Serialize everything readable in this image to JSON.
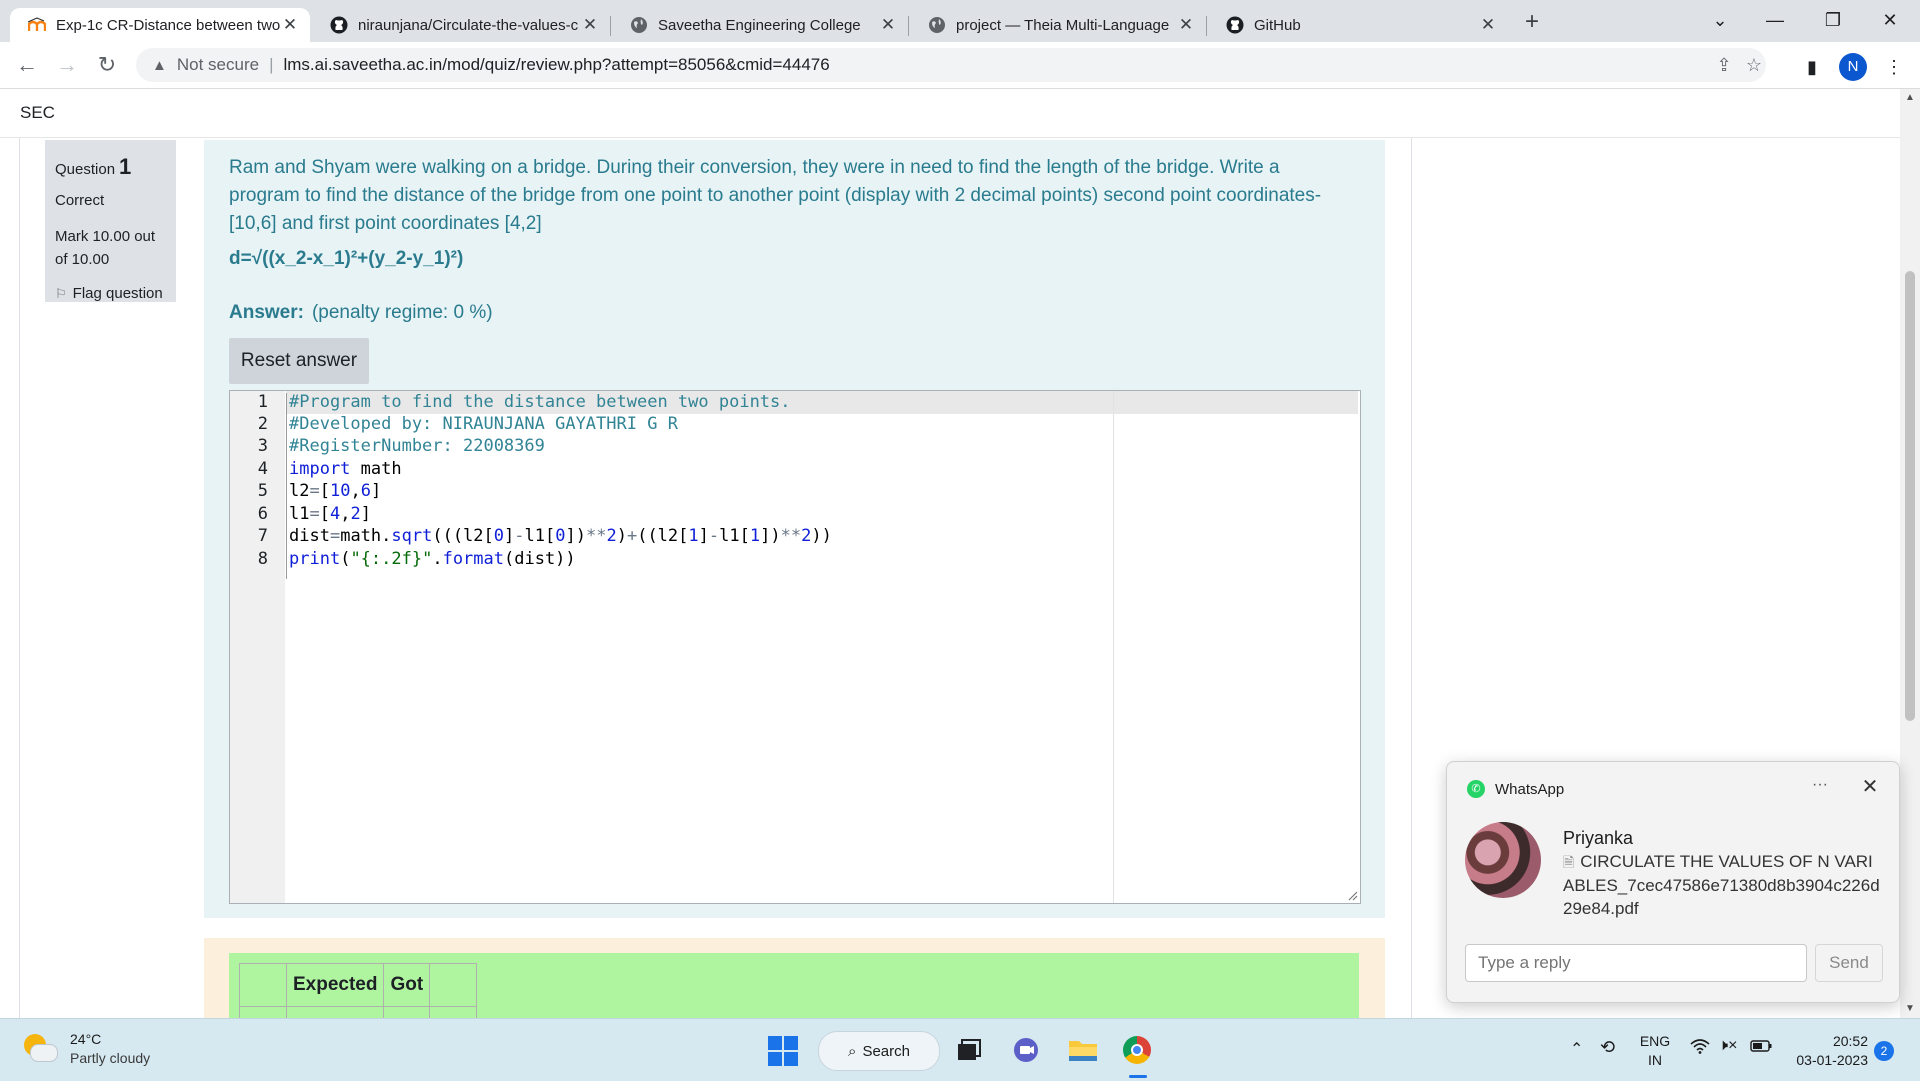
{
  "browser": {
    "tabs": [
      {
        "title": "Exp-1c CR-Distance between two",
        "icon": "moodle-icon",
        "active": true
      },
      {
        "title": "niraunjana/Circulate-the-values-c",
        "icon": "github-icon"
      },
      {
        "title": "Saveetha Engineering College",
        "icon": "globe-icon"
      },
      {
        "title": "project — Theia Multi-Language",
        "icon": "globe-icon"
      },
      {
        "title": "GitHub",
        "icon": "github-icon"
      }
    ],
    "security_label": "Not secure",
    "url": "lms.ai.saveetha.ac.in/mod/quiz/review.php?attempt=85056&cmid=44476",
    "profile_initial": "N"
  },
  "site": {
    "brand": "SEC"
  },
  "question": {
    "label": "Question",
    "number": "1",
    "state": "Correct",
    "mark_line1": "Mark 10.00 out",
    "mark_line2": "of 10.00",
    "flag_label": "Flag question",
    "text": "Ram and Shyam were walking on a bridge. During their conversion, they were in need to find the length of the bridge. Write a program to find the distance of the bridge from one point to another point (display with 2 decimal points) second point coordinates- [10,6] and first point coordinates [4,2]",
    "formula": "d=√((x_2-x_1)²+(y_2-y_1)²)",
    "answer_label": "Answer:",
    "penalty": "(penalty regime: 0 %)",
    "reset_label": "Reset answer"
  },
  "code": {
    "line_numbers": [
      "1",
      "2",
      "3",
      "4",
      "5",
      "6",
      "7",
      "8"
    ],
    "lines": [
      "#Program to find the distance between two points.",
      "#Developed by: NIRAUNJANA GAYATHRI G R",
      "#RegisterNumber: 22008369",
      "import math",
      "l2=[10,6]",
      "l1=[4,2]",
      "dist=math.sqrt(((l2[0]-l1[0])**2)+((l2[1]-l1[1])**2))",
      "print(\"{:.2f}\".format(dist))"
    ]
  },
  "results": {
    "col_expected": "Expected",
    "col_got": "Got"
  },
  "notification": {
    "app": "WhatsApp",
    "sender": "Priyanka",
    "message": "CIRCULATE THE VALUES OF N VARIABLES_7cec47586e71380d8b3904c226d29e84.pdf",
    "reply_placeholder": "Type a reply",
    "send_label": "Send"
  },
  "taskbar": {
    "temperature": "24°C",
    "weather": "Partly cloudy",
    "search_label": "Search",
    "lang1": "ENG",
    "lang2": "IN",
    "time": "20:52",
    "date": "03-01-2023",
    "notification_count": "2"
  },
  "colors": {
    "question_bg": "#e7f3f5",
    "question_text": "#2a7b8e",
    "result_bg": "#aff5a0",
    "outcome_bg": "#fcefdc"
  }
}
